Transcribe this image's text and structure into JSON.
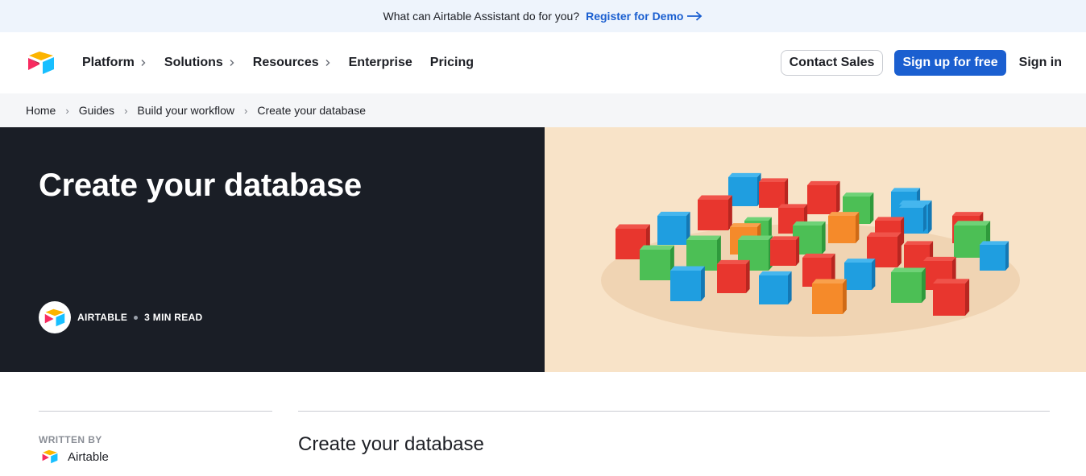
{
  "announcement": {
    "text": "What can Airtable Assistant do for you?",
    "link_label": "Register for Demo"
  },
  "nav": {
    "logo": "airtable-logo",
    "items": [
      {
        "label": "Platform",
        "has_chevron": true
      },
      {
        "label": "Solutions",
        "has_chevron": true
      },
      {
        "label": "Resources",
        "has_chevron": true
      },
      {
        "label": "Enterprise",
        "has_chevron": false
      },
      {
        "label": "Pricing",
        "has_chevron": false
      }
    ],
    "contact_label": "Contact Sales",
    "signup_label": "Sign up for free",
    "signin_label": "Sign in"
  },
  "breadcrumb": [
    "Home",
    "Guides",
    "Build your workflow",
    "Create your database"
  ],
  "hero": {
    "title": "Create your database",
    "author": "AIRTABLE",
    "read_time": "3 MIN READ",
    "image": "colorful-wooden-blocks-photo"
  },
  "sidebar": {
    "written_by_label": "WRITTEN BY",
    "author": "Airtable"
  },
  "article": {
    "title": "Create your database"
  },
  "colors": {
    "accent_blue": "#1b5fd0",
    "hero_dark": "#1a1e26",
    "hero_image_bg": "#f8e3c8",
    "announce_bg": "#eef4fc"
  }
}
